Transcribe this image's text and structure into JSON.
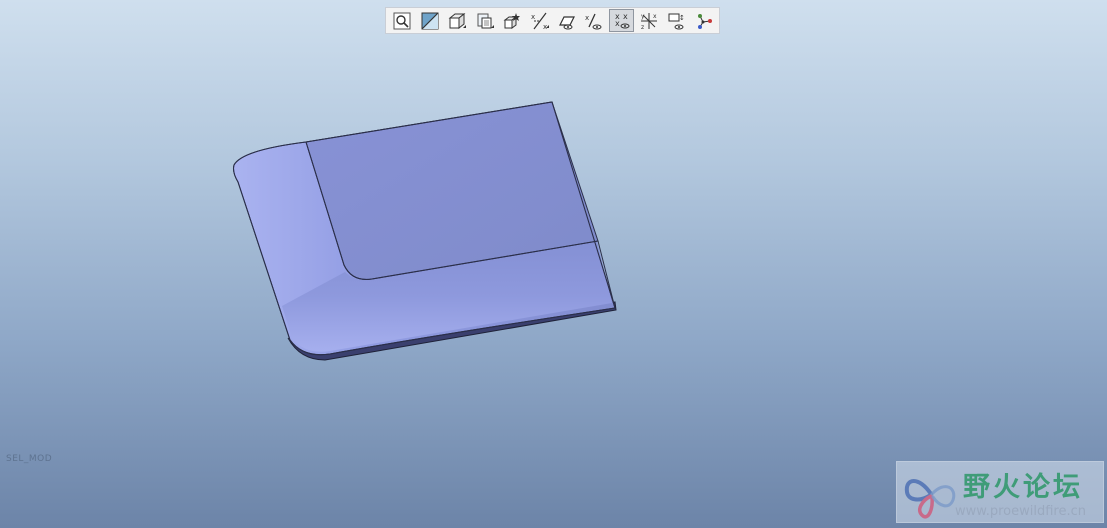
{
  "viewport": {
    "background_top": "#cfdfee",
    "background_bottom": "#6c84a8"
  },
  "toolbar": {
    "buttons": [
      {
        "name": "zoom-fit-icon",
        "active": false
      },
      {
        "name": "repaint-icon",
        "active": false
      },
      {
        "name": "display-style-icon",
        "active": false
      },
      {
        "name": "saved-views-icon",
        "active": false
      },
      {
        "name": "view-manager-icon",
        "active": false
      },
      {
        "name": "datum-planes-icon",
        "active": false
      },
      {
        "name": "datum-axes-icon",
        "active": false
      },
      {
        "name": "datum-points-icon",
        "active": false
      },
      {
        "name": "coordinate-systems-icon",
        "active": true
      },
      {
        "name": "annotations-icon",
        "active": false
      },
      {
        "name": "spin-center-icon",
        "active": false
      },
      {
        "name": "network-icon",
        "active": false
      }
    ]
  },
  "model": {
    "face_color": "#8591cf",
    "edge_color": "#2b2f4a"
  },
  "status": {
    "text": "SEL_MOD"
  },
  "watermark": {
    "title": "野火论坛",
    "url": "www.proewildfire.cn",
    "title_color": "#3f9c78"
  }
}
